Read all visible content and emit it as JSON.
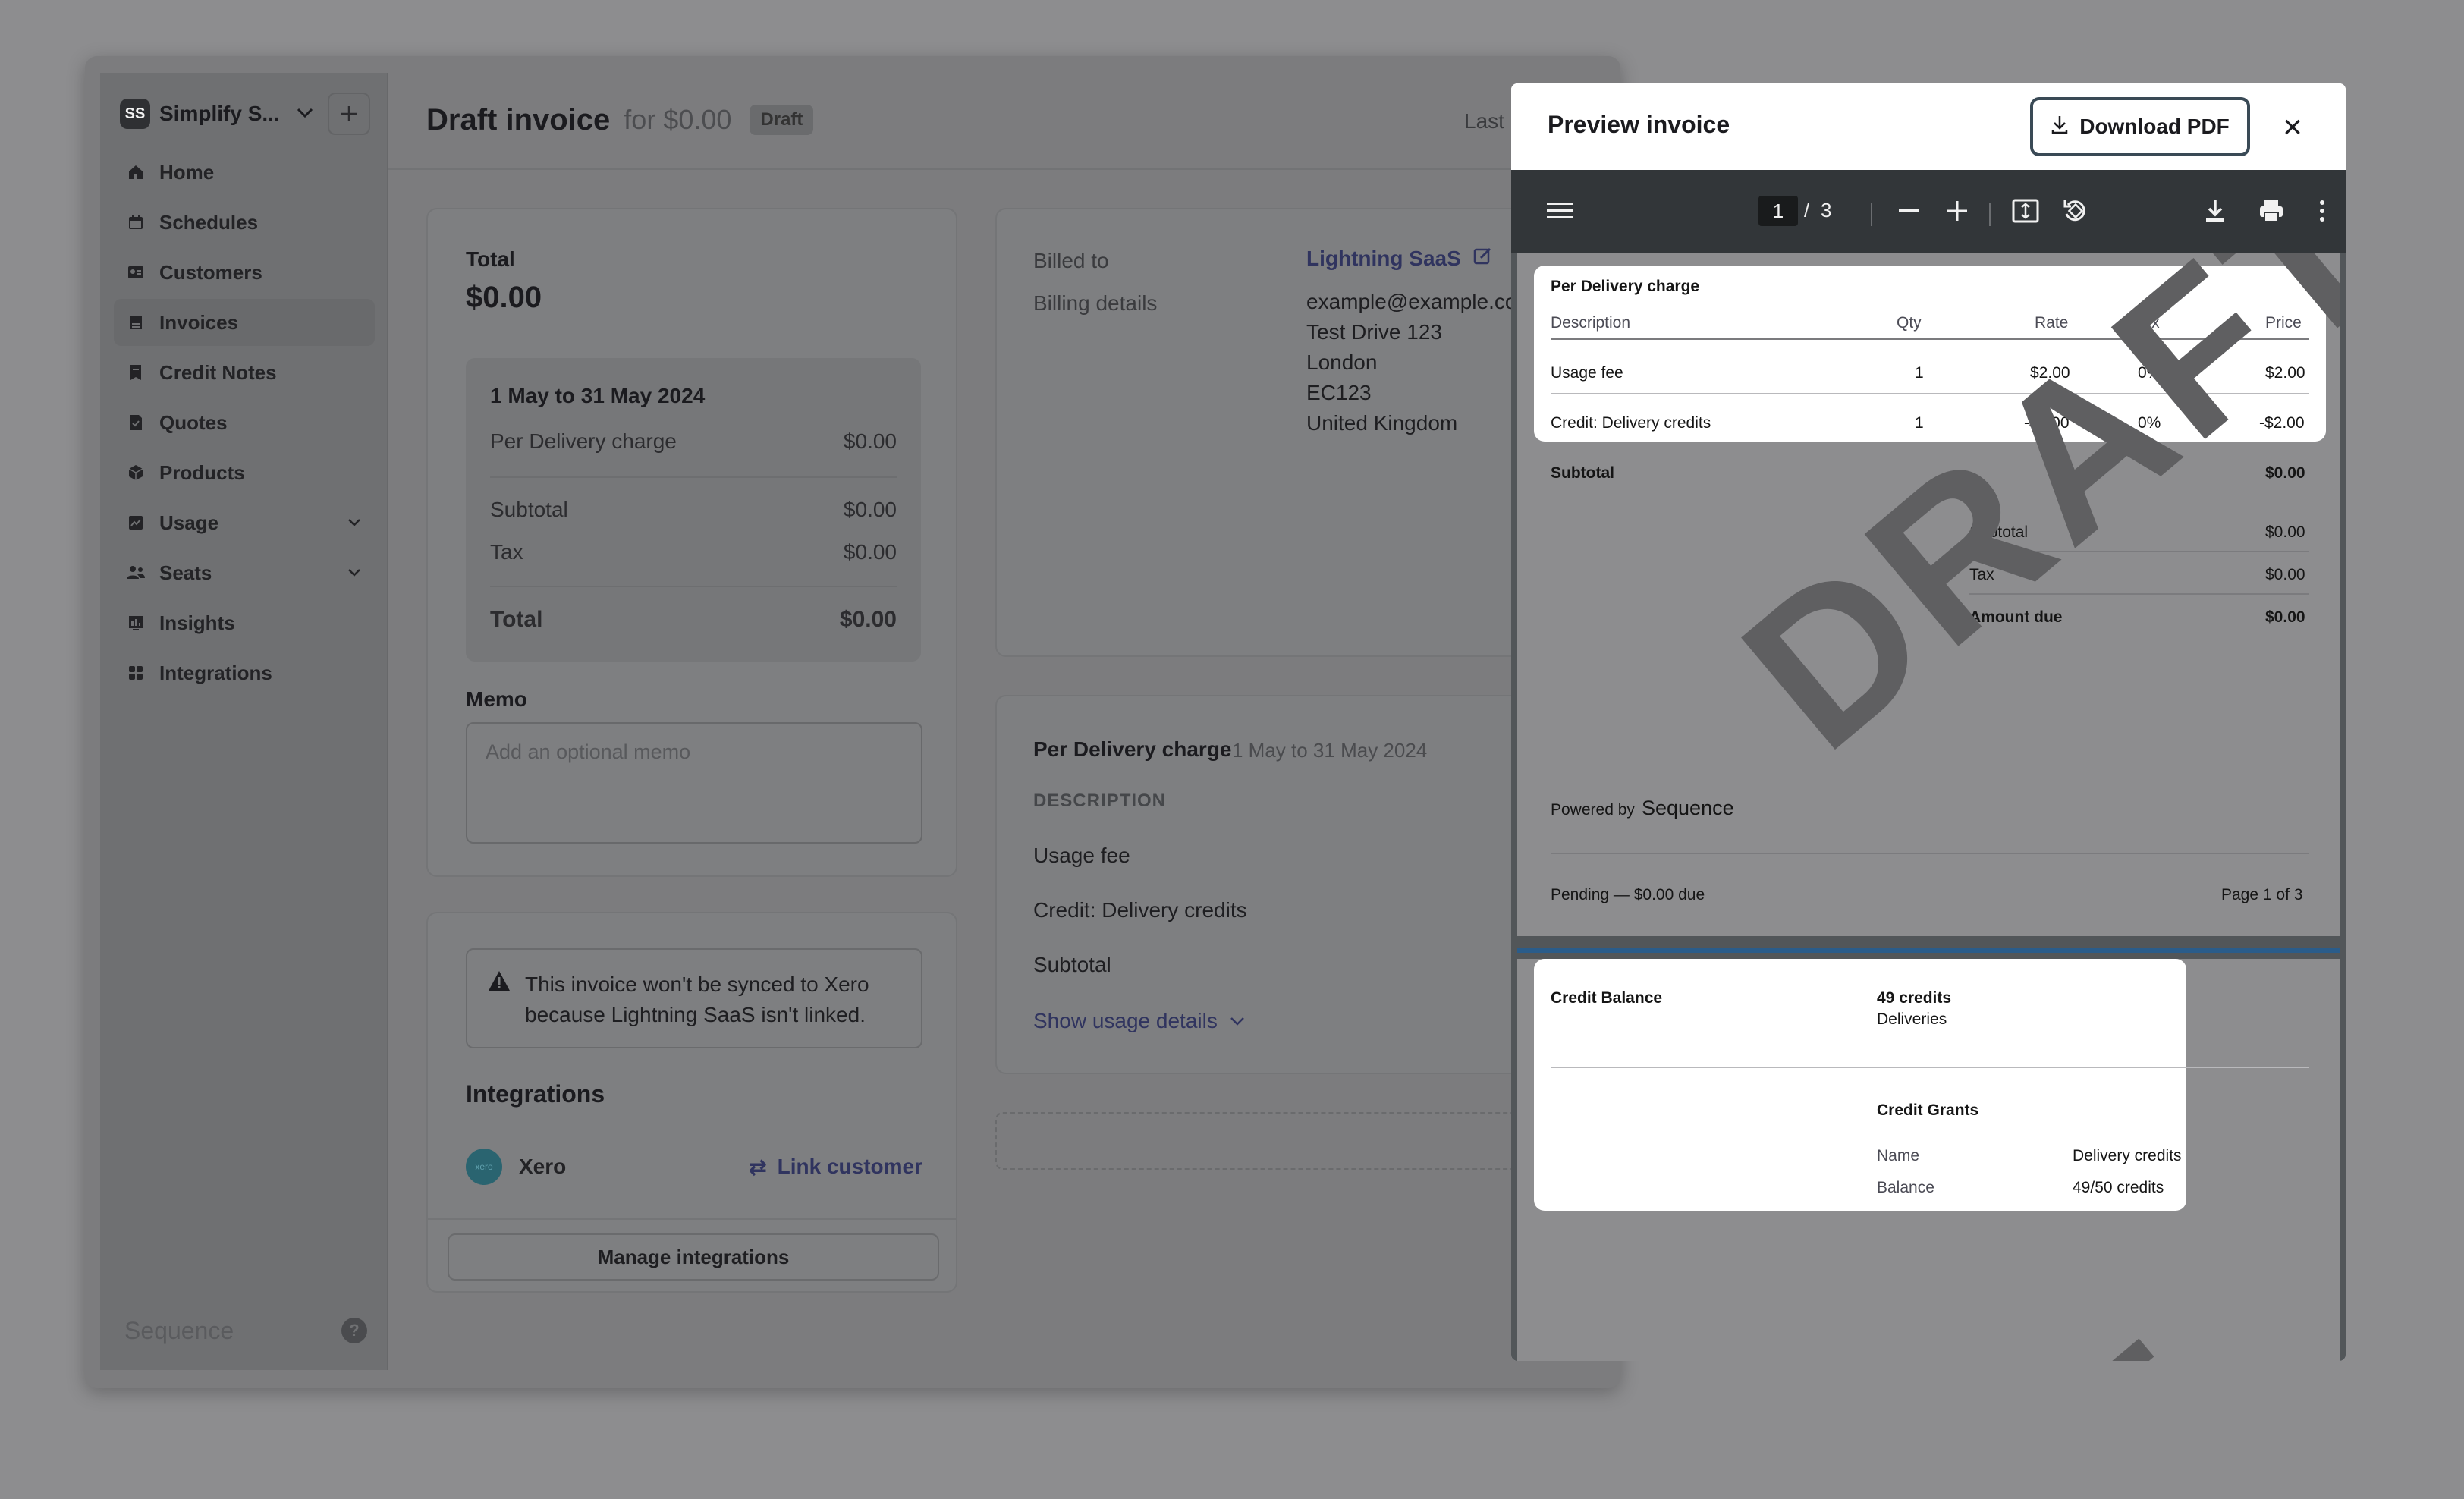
{
  "workspace": {
    "initials": "SS",
    "name": "Simplify S..."
  },
  "nav": [
    {
      "label": "Home",
      "icon": "home-icon"
    },
    {
      "label": "Schedules",
      "icon": "calendar-icon"
    },
    {
      "label": "Customers",
      "icon": "customers-icon"
    },
    {
      "label": "Invoices",
      "icon": "invoice-icon",
      "active": true
    },
    {
      "label": "Credit Notes",
      "icon": "credit-note-icon"
    },
    {
      "label": "Quotes",
      "icon": "quote-icon"
    },
    {
      "label": "Products",
      "icon": "cube-icon"
    },
    {
      "label": "Usage",
      "icon": "usage-icon",
      "expandable": true
    },
    {
      "label": "Seats",
      "icon": "seats-icon",
      "expandable": true
    },
    {
      "label": "Insights",
      "icon": "chart-icon"
    },
    {
      "label": "Integrations",
      "icon": "grid-icon"
    }
  ],
  "sidebar_footer": {
    "logo": "Sequence",
    "help": "?"
  },
  "header": {
    "title": "Draft invoice",
    "amount": "for $0.00",
    "status": "Draft",
    "last": "Last"
  },
  "total_card": {
    "label": "Total",
    "value": "$0.00",
    "period": "1 May to 31 May 2024",
    "charge_label": "Per Delivery charge",
    "charge_value": "$0.00",
    "subtotal_label": "Subtotal",
    "subtotal_value": "$0.00",
    "tax_label": "Tax",
    "tax_value": "$0.00",
    "total_label": "Total",
    "total_value": "$0.00",
    "memo_label": "Memo",
    "memo_placeholder": "Add an optional memo"
  },
  "xero_card": {
    "warning": "This invoice won't be synced to Xero because Lightning SaaS isn't linked.",
    "integrations_title": "Integrations",
    "xero_logo": "xero",
    "xero_name": "Xero",
    "link_label": "Link customer",
    "manage_label": "Manage integrations"
  },
  "billed_card": {
    "billed_to_label": "Billed to",
    "customer": "Lightning SaaS",
    "billing_details_label": "Billing details",
    "email": "example@example.cor",
    "address": [
      "Test Drive 123",
      "London",
      "EC123",
      "United Kingdom"
    ]
  },
  "charge_card": {
    "title": "Per Delivery charge",
    "period": "1 May to 31 May 2024",
    "desc_header": "DESCRIPTION",
    "rows": [
      "Usage fee",
      "Credit: Delivery credits",
      "Subtotal"
    ],
    "show_usage": "Show usage details"
  },
  "preview": {
    "title": "Preview invoice",
    "download_label": "Download PDF",
    "close": "×",
    "toolbar": {
      "page_current": "1",
      "page_sep": "/",
      "page_total": "3"
    },
    "watermark": "DRAFT",
    "watermark2": "T",
    "page1": {
      "section_title": "Per Delivery charge",
      "cols": [
        "Description",
        "Qty",
        "Rate",
        "Tax",
        "Price"
      ],
      "rows": [
        [
          "Usage fee",
          "1",
          "$2.00",
          "0%",
          "$2.00"
        ],
        [
          "Credit: Delivery credits",
          "1",
          "-$2.00",
          "0%",
          "-$2.00"
        ]
      ],
      "subtotal_label": "Subtotal",
      "subtotal_value": "$0.00",
      "summary": [
        {
          "label": "Subtotal",
          "value": "$0.00"
        },
        {
          "label": "Tax",
          "value": "$0.00"
        },
        {
          "label": "Amount due",
          "value": "$0.00"
        }
      ],
      "powered_by": "Powered by",
      "powered_brand": "Sequence",
      "footer_left": "Pending — $0.00 due",
      "footer_right": "Page 1 of 3"
    },
    "page2": {
      "credit_balance_label": "Credit Balance",
      "credit_amount": "49 credits",
      "credit_unit": "Deliveries",
      "grants_title": "Credit Grants",
      "name_label": "Name",
      "name_value": "Delivery credits",
      "balance_label": "Balance",
      "balance_value": "49/50 credits"
    }
  }
}
